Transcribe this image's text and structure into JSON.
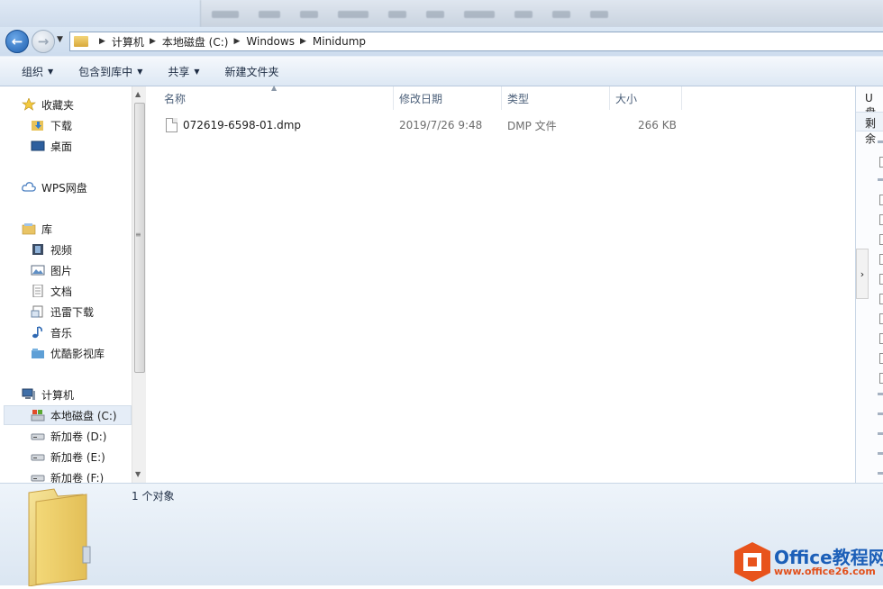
{
  "address": {
    "crumbs": [
      "计算机",
      "本地磁盘 (C:)",
      "Windows",
      "Minidump"
    ]
  },
  "toolbar": {
    "organize": "组织",
    "include_in_library": "包含到库中",
    "share": "共享",
    "new_folder": "新建文件夹"
  },
  "nav": {
    "favorites": "收藏夹",
    "downloads": "下载",
    "desktop": "桌面",
    "wps_cloud": "WPS网盘",
    "libraries": "库",
    "videos": "视频",
    "pictures": "图片",
    "documents": "文档",
    "thunder": "迅雷下载",
    "music": "音乐",
    "youku": "优酷影视库",
    "computer": "计算机",
    "drive_c": "本地磁盘 (C:)",
    "drive_d": "新加卷 (D:)",
    "drive_e": "新加卷 (E:)",
    "drive_f": "新加卷 (F:)"
  },
  "columns": {
    "name": "名称",
    "date": "修改日期",
    "type": "类型",
    "size": "大小"
  },
  "files": [
    {
      "name": "072619-6598-01.dmp",
      "date": "2019/7/26 9:48",
      "type": "DMP 文件",
      "size": "266 KB"
    }
  ],
  "preview": {
    "title": "U盘",
    "sub": "剩余"
  },
  "status": {
    "count": "1 个对象"
  },
  "watermark": {
    "title": "Office教程网",
    "url": "www.office26.com"
  },
  "colors": {
    "accent": "#1c5fb8",
    "watermark_orange": "#e24f1a",
    "toolbar_bg": "#dde8f4"
  }
}
